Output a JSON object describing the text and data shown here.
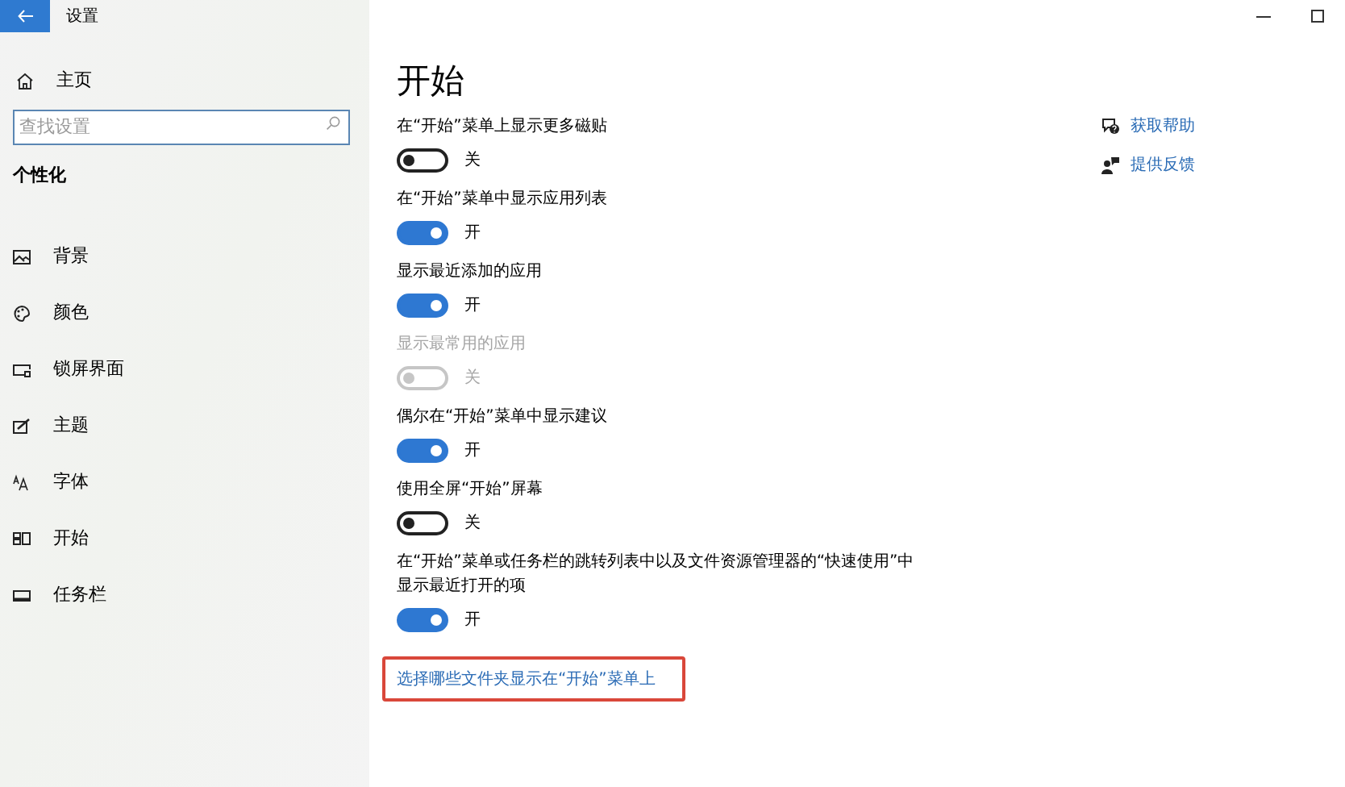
{
  "window": {
    "title": "设置"
  },
  "sidebar": {
    "home": "主页",
    "search": {
      "placeholder": "查找设置"
    },
    "section": "个性化",
    "items": [
      {
        "label": "背景",
        "kind": "picture",
        "selected": false
      },
      {
        "label": "颜色",
        "kind": "palette",
        "selected": false
      },
      {
        "label": "锁屏界面",
        "kind": "lock",
        "selected": false
      },
      {
        "label": "主题",
        "kind": "theme",
        "selected": false
      },
      {
        "label": "字体",
        "kind": "font",
        "selected": false
      },
      {
        "label": "开始",
        "kind": "start",
        "selected": false
      },
      {
        "label": "任务栏",
        "kind": "taskbar",
        "selected": false
      }
    ]
  },
  "main": {
    "title": "开始",
    "settings": [
      {
        "label": "在“开始”菜单上显示更多磁贴",
        "on": false,
        "disabled": false,
        "state": "关"
      },
      {
        "label": "在“开始”菜单中显示应用列表",
        "on": true,
        "disabled": false,
        "state": "开"
      },
      {
        "label": "显示最近添加的应用",
        "on": true,
        "disabled": false,
        "state": "开"
      },
      {
        "label": "显示最常用的应用",
        "on": false,
        "disabled": true,
        "state": "关"
      },
      {
        "label": "偶尔在“开始”菜单中显示建议",
        "on": true,
        "disabled": false,
        "state": "开"
      },
      {
        "label": "使用全屏“开始”屏幕",
        "on": false,
        "disabled": false,
        "state": "关"
      },
      {
        "label": "在“开始”菜单或任务栏的跳转列表中以及文件资源管理器的“快速使用”中显示最近打开的项",
        "on": true,
        "disabled": false,
        "state": "开"
      }
    ],
    "link": "选择哪些文件夹显示在“开始”菜单上"
  },
  "help": [
    {
      "label": "获取帮助",
      "kind": "help"
    },
    {
      "label": "提供反馈",
      "kind": "feedback"
    }
  ]
}
